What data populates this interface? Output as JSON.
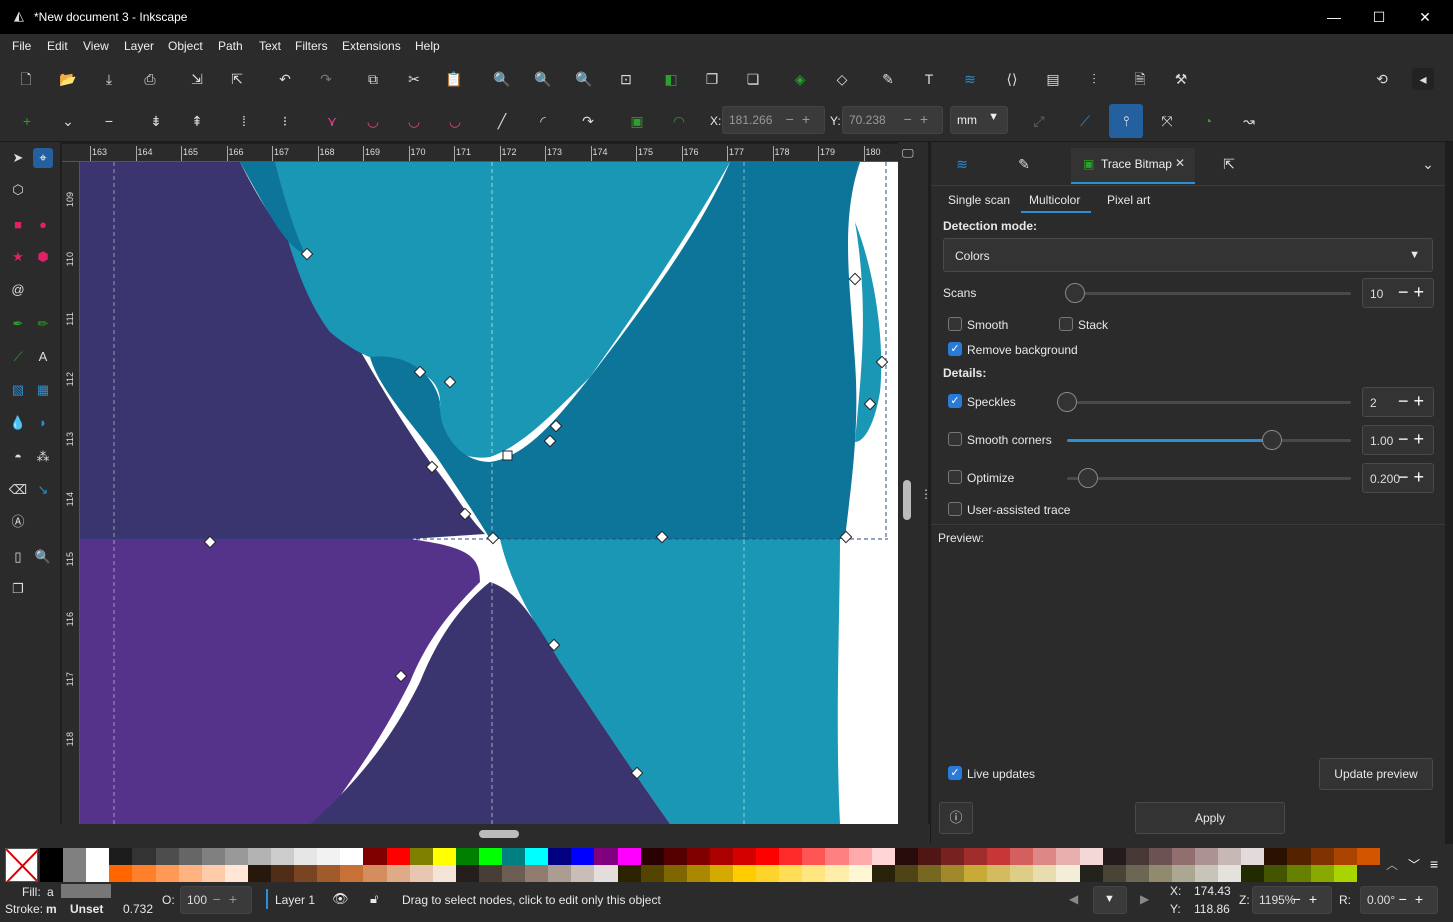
{
  "window": {
    "title": "*New document 3 - Inkscape",
    "minimize": "—",
    "maximize": "☐",
    "close": "✕"
  },
  "menu": [
    "File",
    "Edit",
    "View",
    "Layer",
    "Object",
    "Path",
    "Text",
    "Filters",
    "Extensions",
    "Help"
  ],
  "ctrlbar": {
    "x_label": "X:",
    "x_value": "181.266",
    "y_label": "Y:",
    "y_value": "70.238",
    "unit": "mm"
  },
  "ruler": {
    "h_ticks": [
      "163",
      "164",
      "165",
      "166",
      "167",
      "168",
      "169",
      "170",
      "171",
      "172",
      "173",
      "174",
      "175",
      "176",
      "177",
      "178",
      "179",
      "180"
    ],
    "v_ticks": [
      "109",
      "110",
      "111",
      "112",
      "113",
      "114",
      "115",
      "116",
      "117",
      "118"
    ]
  },
  "dock": {
    "tab_label": "Trace Bitmap",
    "subtabs": [
      "Single scan",
      "Multicolor",
      "Pixel art"
    ],
    "active_subtab": "Multicolor",
    "detection_mode_label": "Detection mode:",
    "detection_mode_value": "Colors",
    "scans_label": "Scans",
    "scans_value": "10",
    "scans_level": 0,
    "smooth_label": "Smooth",
    "stack_label": "Stack",
    "remove_background_label": "Remove background",
    "details_label": "Details:",
    "speckles_label": "Speckles",
    "speckles_value": "2",
    "speckles_level": 0,
    "smooth_corners_label": "Smooth corners",
    "smooth_corners_value": "1.00",
    "smooth_corners_level": 0.74,
    "optimize_label": "Optimize",
    "optimize_value": "0.200",
    "optimize_level": 0.04,
    "user_assisted_label": "User-assisted trace",
    "preview_label": "Preview:",
    "live_updates_label": "Live updates",
    "update_preview_label": "Update preview",
    "apply_label": "Apply",
    "checks": {
      "smooth": false,
      "stack": false,
      "remove_background": true,
      "speckles": true,
      "smooth_corners": false,
      "optimize": false,
      "user_assisted": false,
      "live_updates": true
    }
  },
  "palette": [
    "#000000",
    "#808080",
    "#ffffff",
    "#1c1c1c",
    "#333333",
    "#4d4d4d",
    "#666666",
    "#808080",
    "#999999",
    "#b3b3b3",
    "#cccccc",
    "#e6e6e6",
    "#f2f2f2",
    "#ffffff",
    "#800000",
    "#ff0000",
    "#808000",
    "#ffff00",
    "#008000",
    "#00ff00",
    "#008080",
    "#00ffff",
    "#000080",
    "#0000ff",
    "#800080",
    "#ff00ff",
    "#2b0000",
    "#550000",
    "#800000",
    "#aa0000",
    "#d40000",
    "#ff0000",
    "#ff2a2a",
    "#ff5555",
    "#ff8080",
    "#ffaaaa",
    "#ffd5d5",
    "#280b0b",
    "#501616",
    "#782121",
    "#a02c2c",
    "#c83737",
    "#d35f5f",
    "#de8787",
    "#e9afaf",
    "#f4d7d7",
    "#241c1c",
    "#483737",
    "#6c5353",
    "#916f6f",
    "#ac9393",
    "#c8b7b7",
    "#e3dbdb",
    "#2b1100",
    "#552200",
    "#803300",
    "#aa4400",
    "#d45500"
  ],
  "palette_row2": [
    "#ff6600",
    "#ff7f2a",
    "#ff9955",
    "#ffb380",
    "#ffccaa",
    "#ffe6d5",
    "#28170b",
    "#502d16",
    "#784421",
    "#a05a2c",
    "#c87137",
    "#d38d5f",
    "#deaa87",
    "#e9c6af",
    "#f4e3d7",
    "#241f1c",
    "#483e37",
    "#6c5d53",
    "#917c6f",
    "#ac9d93",
    "#c8beb7",
    "#e3dedb",
    "#2b2200",
    "#554400",
    "#806600",
    "#aa8800",
    "#d4aa00",
    "#ffcc00",
    "#ffd42a",
    "#ffdd55",
    "#ffe680",
    "#ffeeaa",
    "#fff6d5",
    "#28220b",
    "#504416",
    "#786721",
    "#a0892c",
    "#c8ab37",
    "#d3bc5f",
    "#decd87",
    "#e9ddaf",
    "#f4eed7",
    "#24221c",
    "#484537",
    "#6c6753",
    "#918a6f",
    "#aca793",
    "#c8c4b7",
    "#e3e2db",
    "#222b00",
    "#445500",
    "#668000",
    "#88aa00",
    "#aad400"
  ],
  "status": {
    "fill_label": "Fill:",
    "fill_value": "a",
    "stroke_label": "Stroke:",
    "stroke_value": "m",
    "stroke_unset": "Unset",
    "stroke_width": "0.732",
    "opacity_label": "O:",
    "opacity_value": "100",
    "layer": "Layer 1",
    "message": "Drag to select nodes, click to edit only this object",
    "x_label": "X:",
    "x_value": "174.43",
    "y_label": "Y:",
    "y_value": "118.86",
    "zoom_label": "Z:",
    "zoom_value": "1195%",
    "rotate_label": "R:",
    "rotate_value": "0.00°"
  },
  "colors": {
    "accent": "#2a8fd8",
    "teal": "#1b97b6",
    "dark_teal": "#0e759a",
    "indigo": "#3b356f",
    "purple": "#56338a"
  }
}
